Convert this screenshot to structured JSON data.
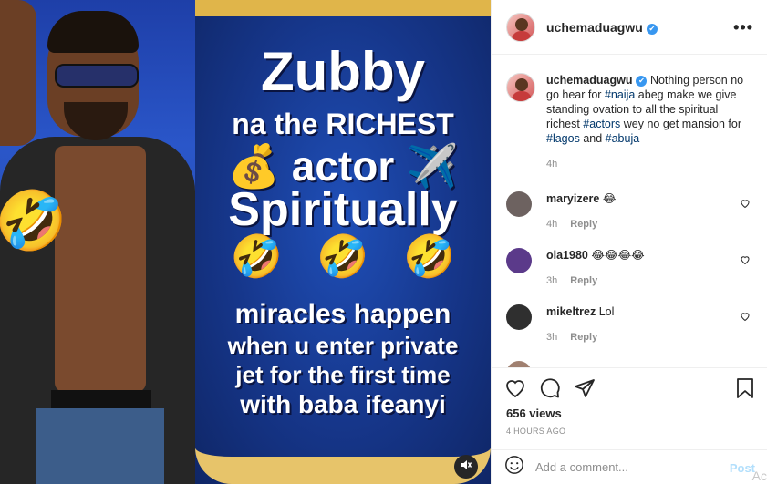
{
  "post": {
    "username": "uchemaduagwu",
    "verified_glyph": "✔",
    "more_label": "•••",
    "poster_lines": [
      "Zubby",
      "na the RICHEST",
      "💰 actor ✈️",
      "Spiritually",
      "miracles happen",
      "when u enter private",
      "jet for the first time",
      "with baba ifeanyi"
    ],
    "poster_emoji_row": [
      "🤣",
      "🤣",
      "🤣"
    ],
    "left_emoji": "🤣",
    "mute_icon": "mute-icon"
  },
  "caption": {
    "username": "uchemaduagwu",
    "text_1": " Nothing person no go hear for ",
    "tag_1": "#naija",
    "text_2": " abeg make we give standing ovation to all the spiritual richest ",
    "tag_2": "#actors",
    "text_3": " wey no get mansion for ",
    "tag_3": "#lagos",
    "text_4": " and ",
    "tag_4": "#abuja",
    "time": "4h"
  },
  "comments": [
    {
      "username": "maryizere",
      "text": "😂",
      "time": "4h",
      "reply": "Reply",
      "avatar_color": "#6d6260"
    },
    {
      "username": "ola1980",
      "text": "😂😂😂😂",
      "time": "3h",
      "reply": "Reply",
      "avatar_color": "#5b3a8a"
    },
    {
      "username": "mikeltrez",
      "text": "Lol",
      "time": "3h",
      "reply": "Reply",
      "avatar_color": "#2f2f2f"
    }
  ],
  "stats": {
    "views": "656 views",
    "time_ago": "4 HOURS AGO"
  },
  "composer": {
    "placeholder": "Add a comment...",
    "post_label": "Post"
  },
  "ad_mark": "Ac",
  "colors": {
    "link": "#00376b",
    "muted": "#8e8e8e",
    "verified": "#3897f0",
    "post_disabled": "#b2dffc",
    "poster_gold": "#e0b54a"
  }
}
